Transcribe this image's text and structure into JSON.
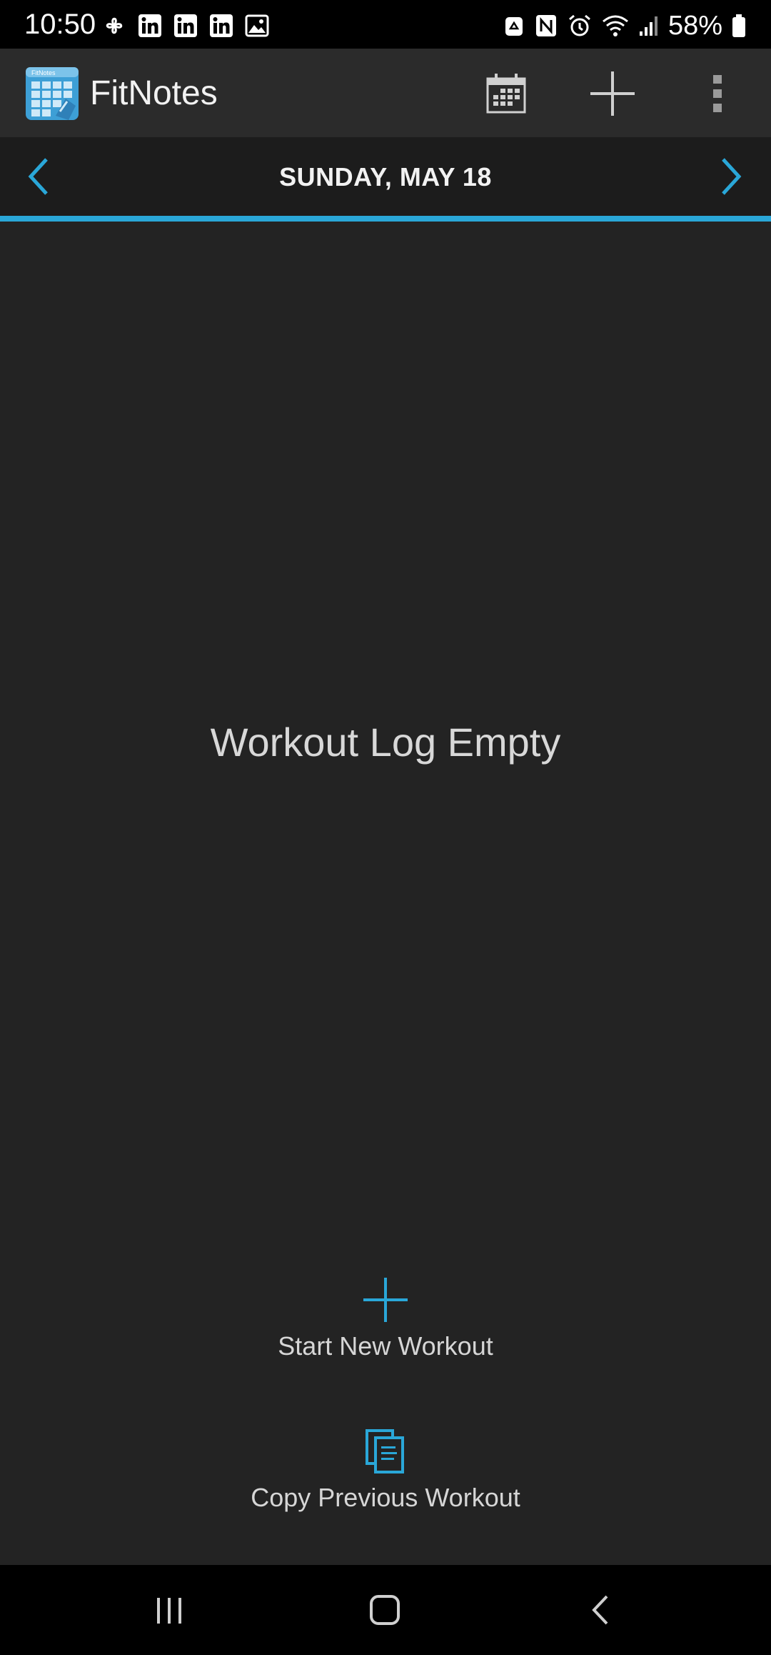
{
  "status_bar": {
    "time": "10:50",
    "battery": "58%",
    "left_icons": [
      "pinwheel-icon",
      "linkedin-icon",
      "linkedin-icon",
      "linkedin-icon",
      "image-icon"
    ],
    "right_icons": [
      "recycle-icon",
      "nfc-icon",
      "alarm-icon",
      "wifi-icon",
      "signal-icon",
      "battery-icon"
    ]
  },
  "app_bar": {
    "title": "FitNotes",
    "logo_label": "FitNotes",
    "actions": [
      "calendar-icon",
      "add-icon",
      "more-vert-icon"
    ]
  },
  "date_bar": {
    "date": "SUNDAY, MAY 18"
  },
  "main": {
    "empty_message": "Workout Log Empty",
    "start_label": "Start New Workout",
    "copy_label": "Copy Previous Workout"
  },
  "colors": {
    "accent": "#2aa7d8",
    "background": "#232323",
    "app_bar": "#2b2b2b",
    "date_bar": "#1c1c1c"
  }
}
